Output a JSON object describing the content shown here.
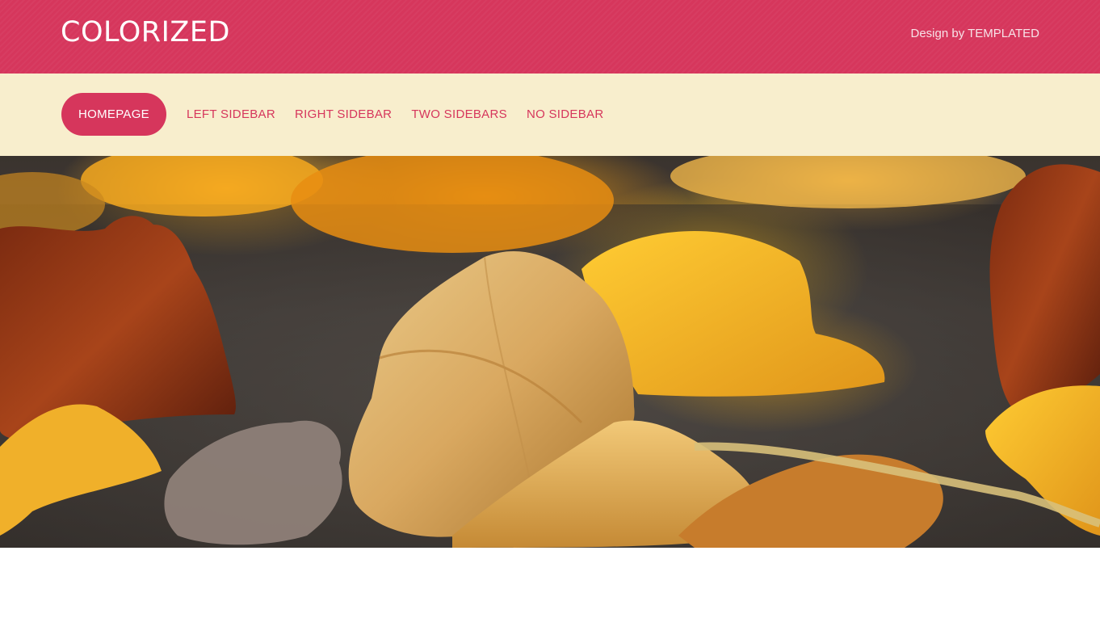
{
  "header": {
    "logo": "COLORIZED",
    "credit": "Design by TEMPLATED"
  },
  "nav": {
    "items": [
      {
        "label": "HOMEPAGE",
        "active": true
      },
      {
        "label": "LEFT SIDEBAR",
        "active": false
      },
      {
        "label": "RIGHT SIDEBAR",
        "active": false
      },
      {
        "label": "TWO SIDEBARS",
        "active": false
      },
      {
        "label": "NO SIDEBAR",
        "active": false
      }
    ]
  },
  "banner": {
    "image": "autumn-leaves-photo"
  },
  "colors": {
    "accent": "#d6365c",
    "nav_background": "#f8eecd",
    "page_background": "#ffffff"
  }
}
